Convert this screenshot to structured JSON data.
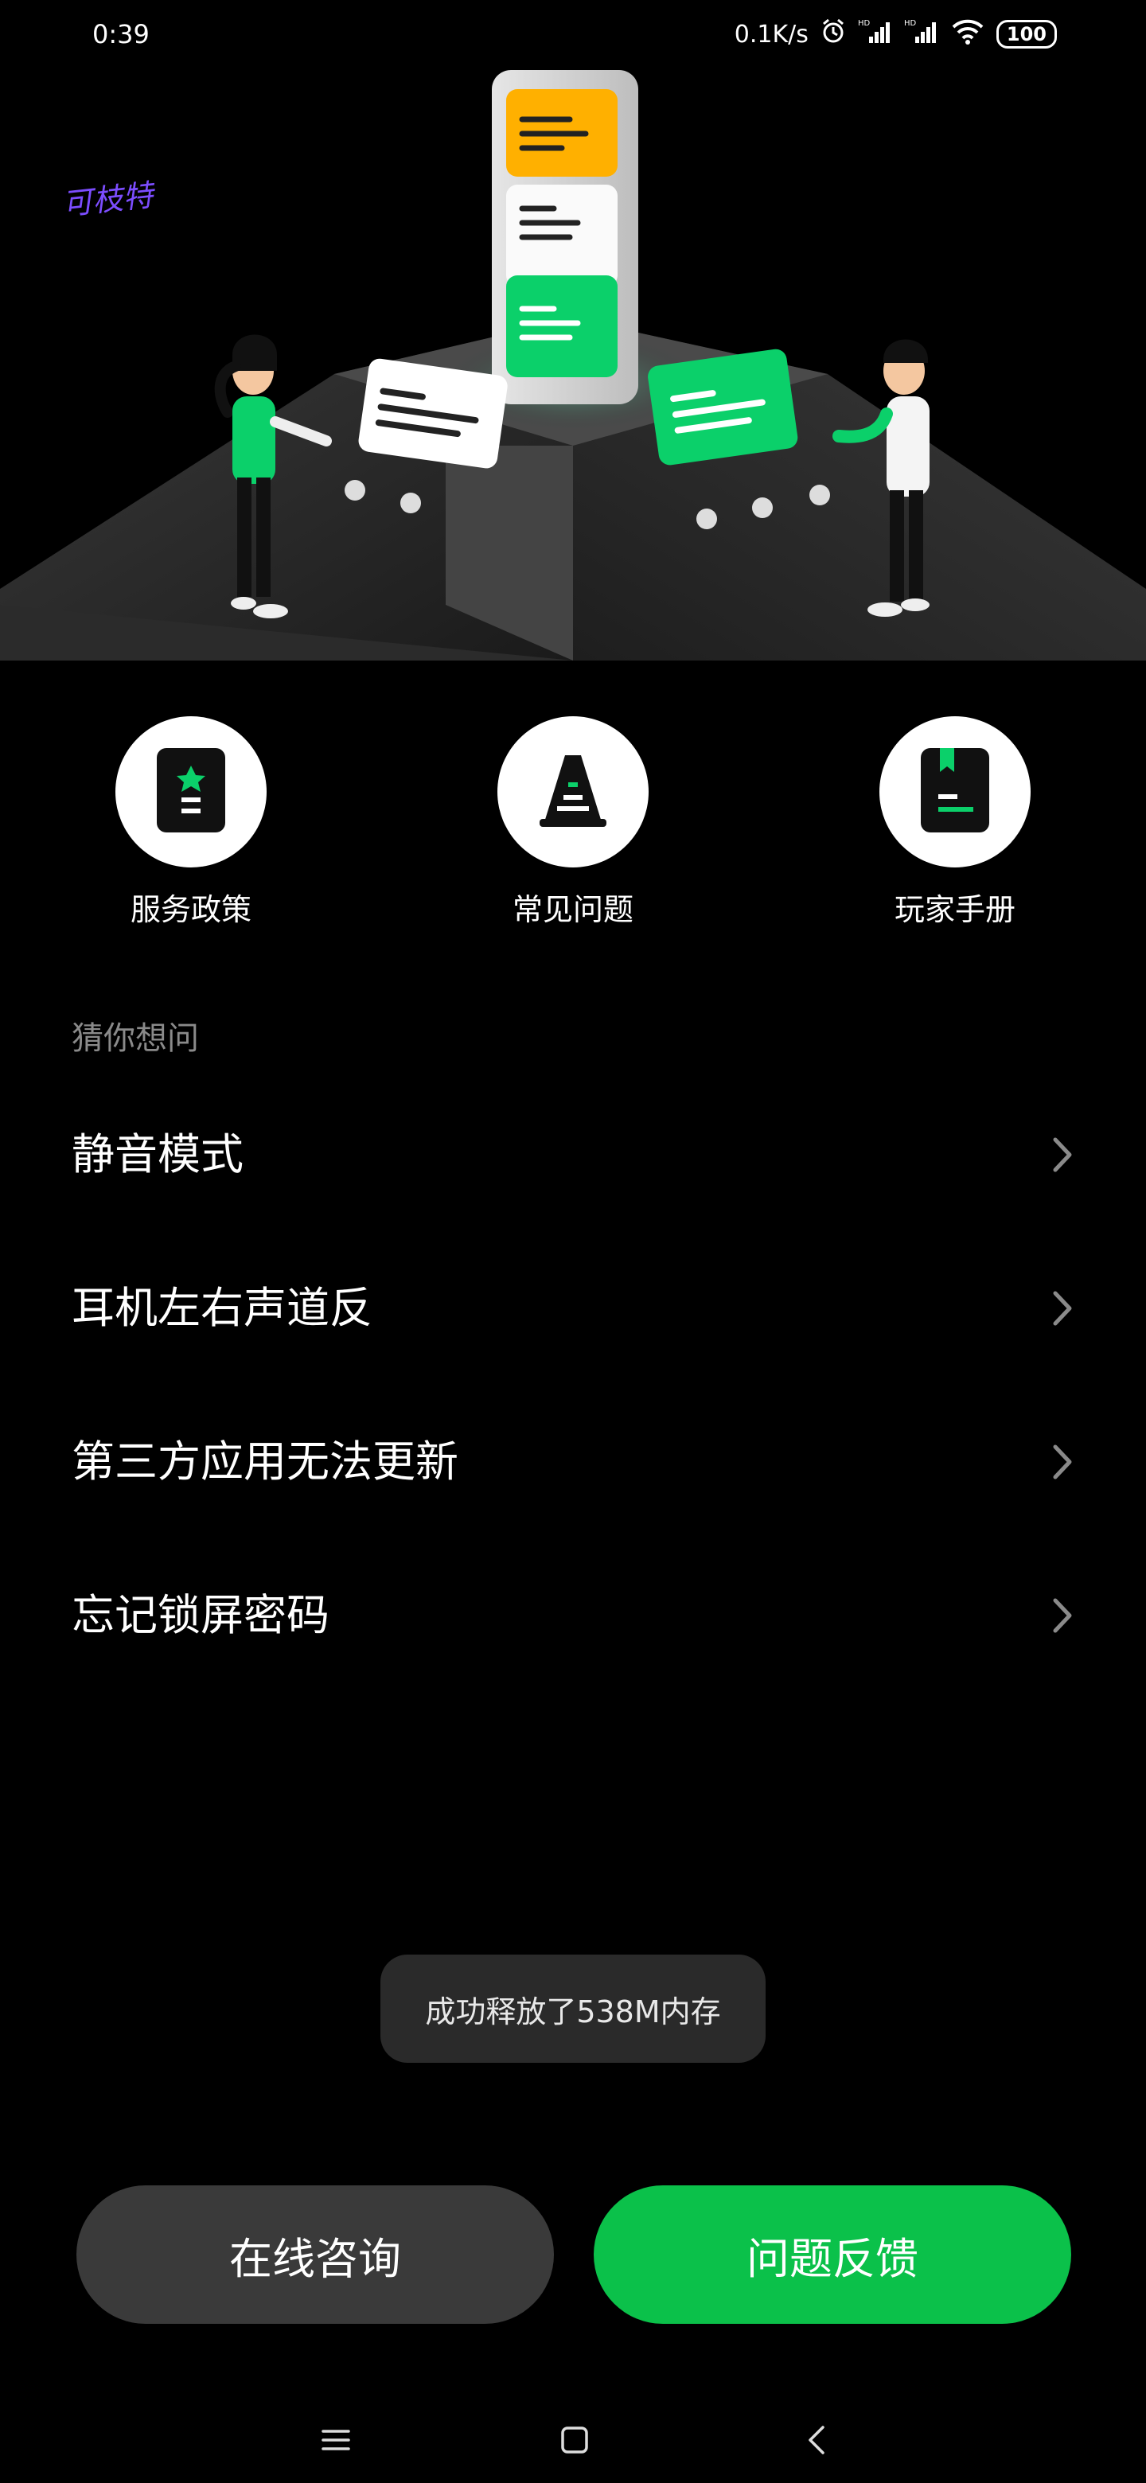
{
  "status_bar": {
    "time": "0:39",
    "net_speed": "0.1K/s",
    "battery": "100",
    "icons": [
      "alarm-icon",
      "hd-signal-icon",
      "hd-signal-icon",
      "wifi-icon",
      "battery-icon"
    ]
  },
  "hero": {
    "signature": "可枝特"
  },
  "shortcuts": [
    {
      "label": "服务政策",
      "icon": "policy-doc-icon"
    },
    {
      "label": "常见问题",
      "icon": "cone-icon"
    },
    {
      "label": "玩家手册",
      "icon": "manual-book-icon"
    }
  ],
  "faq": {
    "section_title": "猜你想问",
    "items": [
      {
        "label": "静音模式"
      },
      {
        "label": "耳机左右声道反"
      },
      {
        "label": "第三方应用无法更新"
      },
      {
        "label": "忘记锁屏密码"
      }
    ]
  },
  "toast": "成功释放了538M内存",
  "actions": {
    "consult_label": "在线咨询",
    "feedback_label": "问题反馈"
  },
  "colors": {
    "accent_green": "#0bc14a",
    "card_orange": "#ffb000",
    "button_dark": "#3a3a3a"
  },
  "nav_bar": {
    "icons": [
      "menu-icon",
      "home-square-icon",
      "back-icon"
    ]
  }
}
